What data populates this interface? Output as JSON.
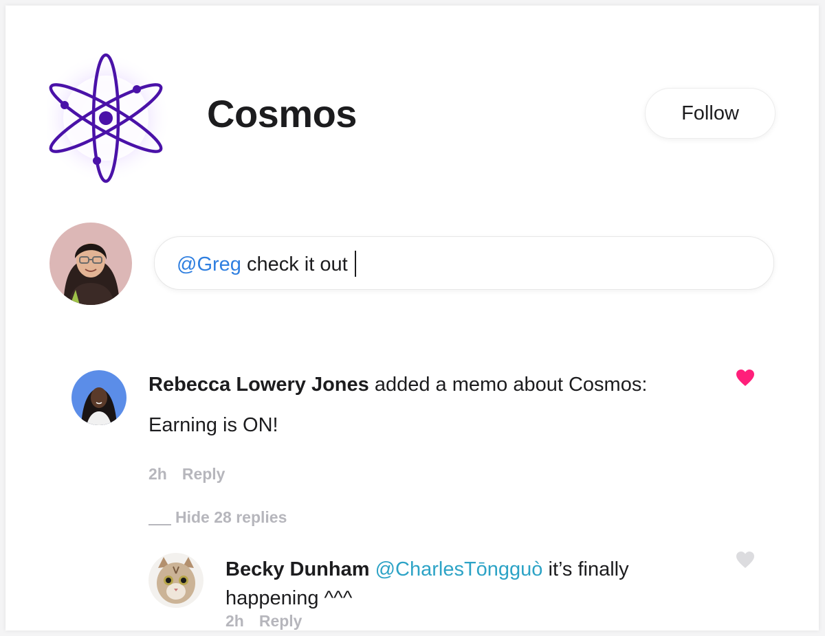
{
  "header": {
    "title": "Cosmos",
    "follow_label": "Follow",
    "logo_icon": "atom-icon",
    "logo_color": "#4a12a8"
  },
  "composer": {
    "mention": "@Greg",
    "text": " check it out"
  },
  "comments": [
    {
      "author": "Rebecca Lowery Jones",
      "action": " added a memo about Cosmos:",
      "body": "Earning is ON!",
      "time": "2h",
      "reply_label": "Reply",
      "liked": true,
      "heart_color": "#ff1f7a"
    }
  ],
  "thread": {
    "hide_label": "Hide 28 replies",
    "replies": [
      {
        "author": "Becky Dunham",
        "mention": "@CharlesTōngguò",
        "text_line1": " it’s finally",
        "text_line2": "happening ^^^",
        "time": "2h",
        "reply_label": "Reply",
        "liked": false,
        "heart_color": "#dcdcdf"
      }
    ]
  }
}
